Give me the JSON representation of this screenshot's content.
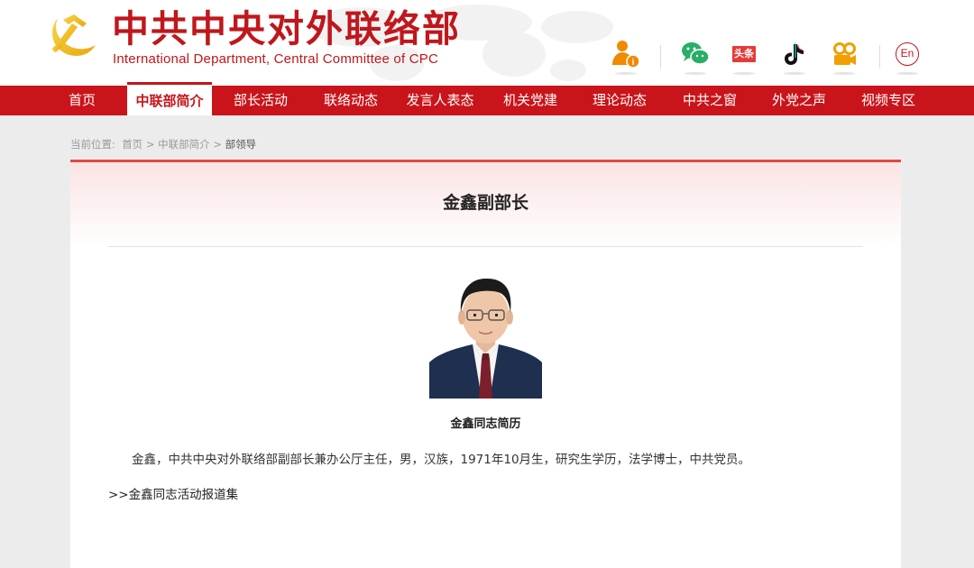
{
  "header": {
    "brand_cn": "中共中央对外联络部",
    "brand_en": "International Department, Central Committee of CPC",
    "social": [
      {
        "icon": "info-person-icon",
        "color": "#f08a00"
      },
      {
        "icon": "wechat-icon",
        "color": "#2aae67"
      },
      {
        "icon": "toutiao-icon",
        "label": "头条",
        "color": "#e63a3a"
      },
      {
        "icon": "tiktok-icon",
        "color": "#111111"
      },
      {
        "icon": "video-channel-icon",
        "color": "#f0a000"
      },
      {
        "icon": "english-version-icon",
        "label": "En",
        "color": "#c8141a"
      }
    ]
  },
  "nav": {
    "items": [
      "首页",
      "中联部简介",
      "部长活动",
      "联络动态",
      "发言人表态",
      "机关党建",
      "理论动态",
      "中共之窗",
      "外党之声",
      "视频专区"
    ],
    "active": "中联部简介"
  },
  "breadcrumb": {
    "prefix": "当前位置:",
    "home": "首页",
    "section": "中联部简介",
    "current": "部领导",
    "separator": ">"
  },
  "article": {
    "title": "金鑫副部长",
    "subtitle": "金鑫同志简历",
    "bio": "金鑫，中共中央对外联络部副部长兼办公厅主任，男，汉族，1971年10月生，研究生学历，法学博士，中共党员。",
    "more_link": ">>金鑫同志活动报道集"
  },
  "colors": {
    "brand_red": "#c8141a",
    "title_red": "#c0171c",
    "card_top_border": "#e04a45",
    "page_bg": "#ececec"
  }
}
